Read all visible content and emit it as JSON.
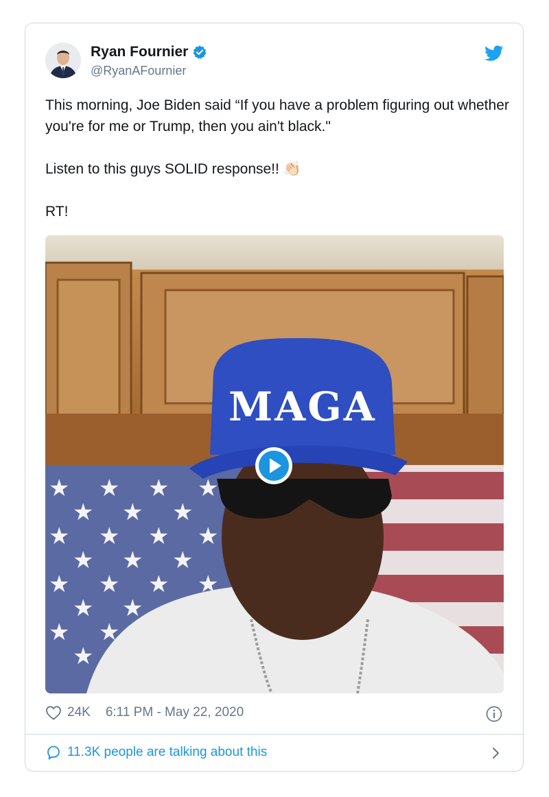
{
  "author": {
    "name": "Ryan Fournier",
    "handle": "@RyanAFournier",
    "verified": true
  },
  "tweet": {
    "line1": "This morning, Joe Biden said “If you have a problem figuring out whether you're for me or Trump, then you ain't black.\"",
    "line2": "Listen to this guys SOLID response!!",
    "line2_emoji": "👏🏻",
    "line3": "RT!"
  },
  "media": {
    "type": "video",
    "cap_text": "MAGA",
    "play_icon": "play-icon"
  },
  "footer": {
    "likes": "24K",
    "timestamp": "6:11 PM - May 22, 2020",
    "talking": "11.3K people are talking about this"
  },
  "colors": {
    "accent": "#1b95e0",
    "text": "#14171a",
    "muted": "#657786",
    "border": "#cfd9de"
  }
}
